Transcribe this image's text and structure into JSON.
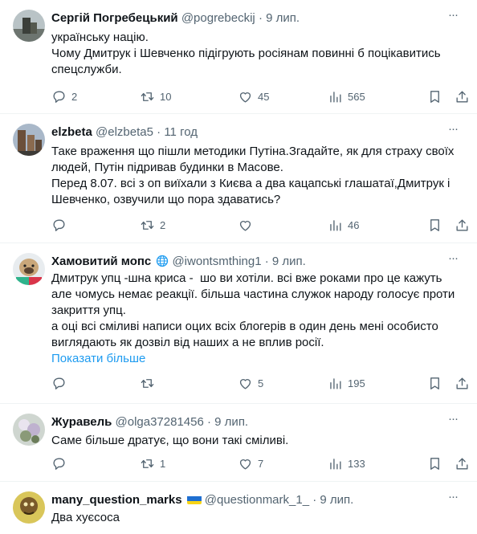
{
  "posts": [
    {
      "name": "Сергій Погребецький",
      "handle": "@pogrebeckij",
      "time": "9 лип.",
      "text": "українську націю.\nЧому Дмитрук і Шевченко підігрують росіянам повинні б поцікавитись\nспецслужби.",
      "replies": "2",
      "reposts": "10",
      "likes": "45",
      "views": "565"
    },
    {
      "name": "elzbeta",
      "handle": "@elzbeta5",
      "time": "11 год",
      "text": "Таке враження що пішли методики Путіна.Згадайте, як для страху своїх\nлюдей, Путін підривав будинки в Масове.\nПеред 8.07. всі з оп виїхали з Києва а два кацапські глашатаї,Дмитрук і\nШевченко, озвучили що пора здаватись?",
      "replies": "",
      "reposts": "2",
      "likes": "",
      "views": "46"
    },
    {
      "name": "Хамовитий мопс",
      "handle": "@iwontsmthing1",
      "time": "9 лип.",
      "text": "Дмитрук упц -шна криса -  шо ви хотіли. всі вже роками про це кажуть\nале чомусь немає реакції. більша частина служок народу голосує проти\nзакриття упц.\nа оці всі сміливі написи оцих всіх блогерів в один день мені особисто\nвиглядають як дозвіл від наших а не вплив росії.",
      "show_more": "Показати більше",
      "replies": "",
      "reposts": "",
      "likes": "5",
      "views": "195"
    },
    {
      "name": "Журавель",
      "handle": "@olga37281456",
      "time": "9 лип.",
      "text": "Саме більше дратує, що вони такі сміливі.",
      "replies": "",
      "reposts": "1",
      "likes": "7",
      "views": "133"
    },
    {
      "name": "many_question_marks",
      "handle": "@questionmark_1_",
      "time": "9 лип.",
      "text": "Два хуєсоса"
    }
  ],
  "dot": "·",
  "icons": {
    "reply": "reply-icon",
    "repost": "repost-icon",
    "like": "heart-icon",
    "views": "views-icon",
    "bookmark": "bookmark-icon",
    "share": "share-icon",
    "more": "more-icon"
  },
  "colors": {
    "link": "#1d9bf0",
    "muted": "#536471",
    "text": "#0f1419",
    "divider": "#eff3f4"
  }
}
